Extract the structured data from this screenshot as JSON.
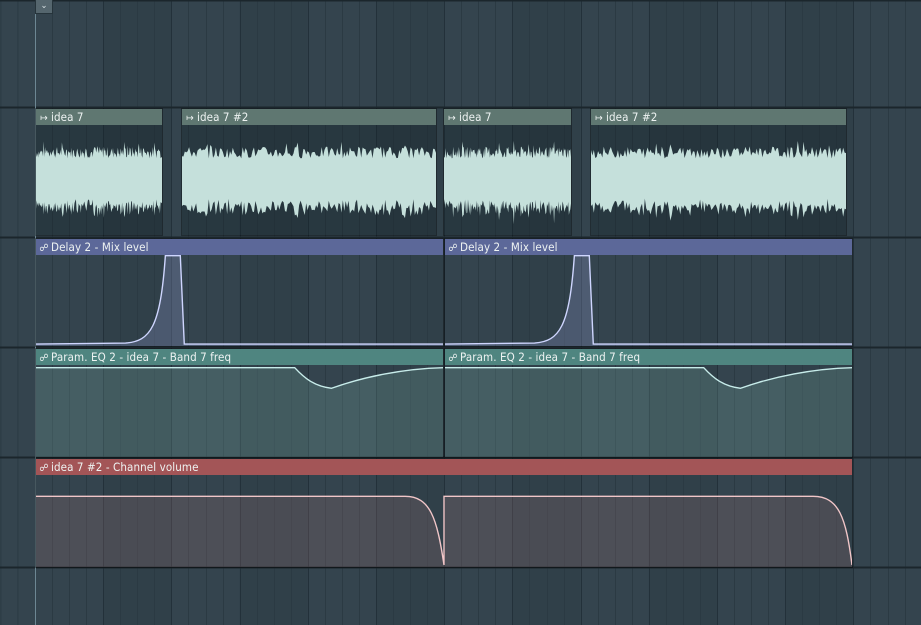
{
  "toolbar": {
    "menu_icon": "chevron-down-icon",
    "menu_glyph": "⌄"
  },
  "colors": {
    "background": "#34444e",
    "track_line": "#1b262c",
    "audio_header": "#5f7771",
    "audio_wave": "#c5e0db",
    "delay_header": "#5c6899",
    "eq_header": "#4f8580",
    "volume_header": "#a35557"
  },
  "clips": [
    {
      "label": "idea 7",
      "kind": "audio",
      "icon": "audio-clip-icon"
    },
    {
      "label": "idea 7 #2",
      "kind": "audio",
      "icon": "audio-clip-icon"
    },
    {
      "label": "idea 7",
      "kind": "audio",
      "icon": "audio-clip-icon"
    },
    {
      "label": "idea 7 #2",
      "kind": "audio",
      "icon": "audio-clip-icon"
    },
    {
      "label": "Delay 2 - Mix level",
      "kind": "automation",
      "icon": "automation-clip-icon"
    },
    {
      "label": "Delay 2 - Mix level",
      "kind": "automation",
      "icon": "automation-clip-icon"
    },
    {
      "label": "Param. EQ 2 - idea 7 - Band 7 freq",
      "kind": "automation",
      "icon": "automation-clip-icon"
    },
    {
      "label": "Param. EQ 2 - idea 7 - Band 7 freq",
      "kind": "automation",
      "icon": "automation-clip-icon"
    },
    {
      "label": "idea 7 #2 - Channel volume",
      "kind": "automation",
      "icon": "automation-clip-icon"
    }
  ]
}
